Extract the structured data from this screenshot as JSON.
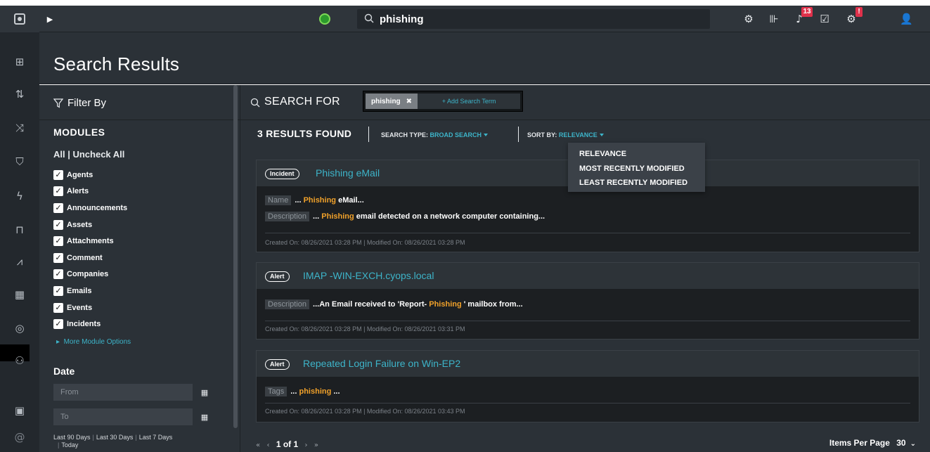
{
  "topbar": {
    "search_value": "phishing",
    "notifications_count": "13",
    "alert_badge": "!"
  },
  "header": {
    "title": "Search Results"
  },
  "filter": {
    "title": "Filter By",
    "modules_title": "MODULES",
    "all_uncheck": "All | Uncheck All",
    "modules": [
      {
        "label": "Agents",
        "checked": true
      },
      {
        "label": "Alerts",
        "checked": true
      },
      {
        "label": "Announcements",
        "checked": true
      },
      {
        "label": "Assets",
        "checked": true
      },
      {
        "label": "Attachments",
        "checked": true
      },
      {
        "label": "Comment",
        "checked": true
      },
      {
        "label": "Companies",
        "checked": true
      },
      {
        "label": "Emails",
        "checked": true
      },
      {
        "label": "Events",
        "checked": true
      },
      {
        "label": "Incidents",
        "checked": true
      }
    ],
    "more_options": "More Module Options",
    "date_title": "Date",
    "from_placeholder": "From",
    "to_placeholder": "To",
    "ranges": [
      "Last 90 Days",
      "Last 30 Days",
      "Last 7 Days",
      "Today"
    ]
  },
  "search_for": {
    "title": "SEARCH FOR",
    "terms": [
      "phishing"
    ],
    "add_term": "+ Add Search Term"
  },
  "results": {
    "count_label": "3 RESULTS FOUND",
    "search_type_label": "SEARCH TYPE:",
    "search_type_value": "BROAD SEARCH",
    "sort_label": "SORT BY:",
    "sort_value": "RELEVANCE",
    "sort_options": [
      "RELEVANCE",
      "MOST RECENTLY MODIFIED",
      "LEAST RECENTLY MODIFIED"
    ]
  },
  "cards": [
    {
      "type": "Incident",
      "title": "Phishing eMail",
      "fields": [
        {
          "label": "Name",
          "pre": "... ",
          "hl": "Phishing",
          "post": " eMail..."
        },
        {
          "label": "Description",
          "pre": "... ",
          "hl": "Phishing",
          "post": " email detected on a network computer containing..."
        }
      ],
      "meta": "Created On:  08/26/2021 03:28 PM   |   Modified On:  08/26/2021 03:28 PM"
    },
    {
      "type": "Alert",
      "title": "IMAP -WIN-EXCH.cyops.local",
      "fields": [
        {
          "label": "Description",
          "pre": "...An Email received to 'Report- ",
          "hl": "Phishing",
          "post": " ' mailbox from..."
        }
      ],
      "meta": "Created On:  08/26/2021 03:28 PM   |   Modified On:  08/26/2021 03:31 PM"
    },
    {
      "type": "Alert",
      "title": "Repeated Login Failure on Win-EP2",
      "fields": [
        {
          "label": "Tags",
          "pre": "... ",
          "hl": "phishing",
          "post": " ..."
        }
      ],
      "meta": "Created On:  08/26/2021 03:28 PM   |   Modified On:  08/26/2021 03:43 PM"
    }
  ],
  "pagination": {
    "page_label": "1 of 1",
    "items_per_page_label": "Items Per Page",
    "items_per_page_value": "30"
  }
}
